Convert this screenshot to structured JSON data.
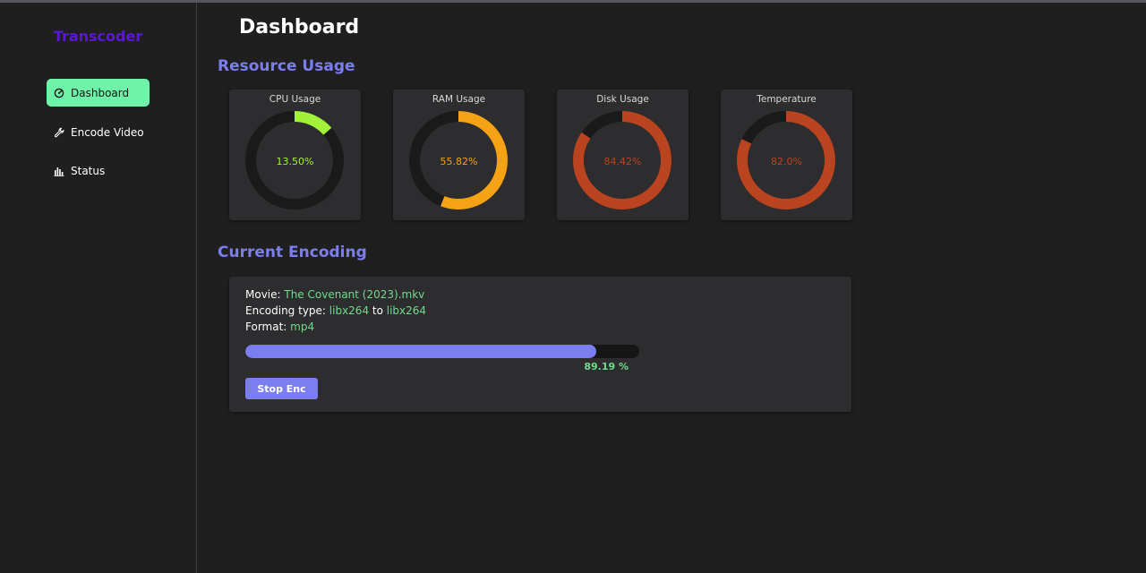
{
  "app": {
    "brand": "Transcoder"
  },
  "sidebar": {
    "items": [
      {
        "label": "Dashboard",
        "icon": "gauge-icon",
        "active": true
      },
      {
        "label": "Encode Video",
        "icon": "wrench-icon",
        "active": false
      },
      {
        "label": "Status",
        "icon": "bar-chart-icon",
        "active": false
      }
    ]
  },
  "header": {
    "title": "Dashboard"
  },
  "resource_usage": {
    "title": "Resource Usage",
    "gauges": [
      {
        "label": "CPU Usage",
        "value_text": "13.50%",
        "percent": 13.5,
        "color": "#a3f23a"
      },
      {
        "label": "RAM Usage",
        "value_text": "55.82%",
        "percent": 55.82,
        "color": "#f5a214"
      },
      {
        "label": "Disk Usage",
        "value_text": "84.42%",
        "percent": 84.42,
        "color": "#b9441f"
      },
      {
        "label": "Temperature",
        "value_text": "82.0%",
        "percent": 82.0,
        "color": "#b9441f"
      }
    ]
  },
  "encoding": {
    "title": "Current Encoding",
    "movie_label": "Movie: ",
    "movie_value": "The Covenant (2023).mkv",
    "type_label": "Encoding type: ",
    "type_from": "libx264",
    "type_to_word": " to ",
    "type_to": "libx264",
    "format_label": "Format: ",
    "format_value": "mp4",
    "progress_percent": 89.19,
    "progress_text": "89.19 %",
    "stop_label": "Stop Enc"
  },
  "colors": {
    "accent": "#7b7ef1",
    "brand": "#5a18d6",
    "active_nav": "#6ff3a8",
    "highlight_text": "#6fdc8c",
    "ring_track": "#1a1a1a"
  }
}
